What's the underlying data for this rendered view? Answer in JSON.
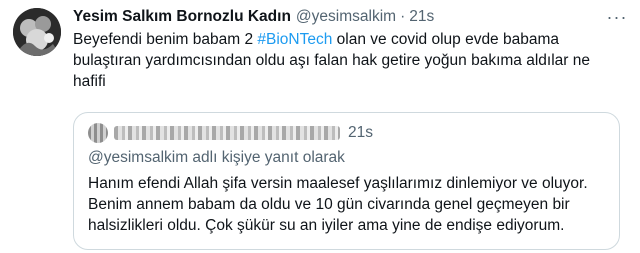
{
  "tweet": {
    "author_name": "Yesim Salkım Bornozlu Kadın",
    "handle": "@yesimsalkim",
    "separator": "·",
    "time": "21s",
    "more_icon": "more-dots-icon",
    "text_before": "Beyefendi benim babam 2 ",
    "hashtag": "#BioNTech",
    "text_after": " olan ve covid olup evde babama bulaştıran yardımcısından oldu aşı falan hak getire yoğun bakıma aldılar ne hafifi"
  },
  "quote": {
    "time": "21s",
    "reply_to": "@yesimsalkim adlı kişiye yanıt olarak",
    "text": "Hanım efendi Allah şifa versin maalesef yaşlılarımız dinlemiyor ve oluyor. Benim annem babam da oldu ve 10 gün civarında genel geçmeyen bir halsizlikleri oldu. Çok şükür su an iyiler ama yine de endişe ediyorum."
  },
  "colors": {
    "link": "#1d9bf0",
    "secondary_text": "#536471",
    "border": "#cfd9de"
  }
}
